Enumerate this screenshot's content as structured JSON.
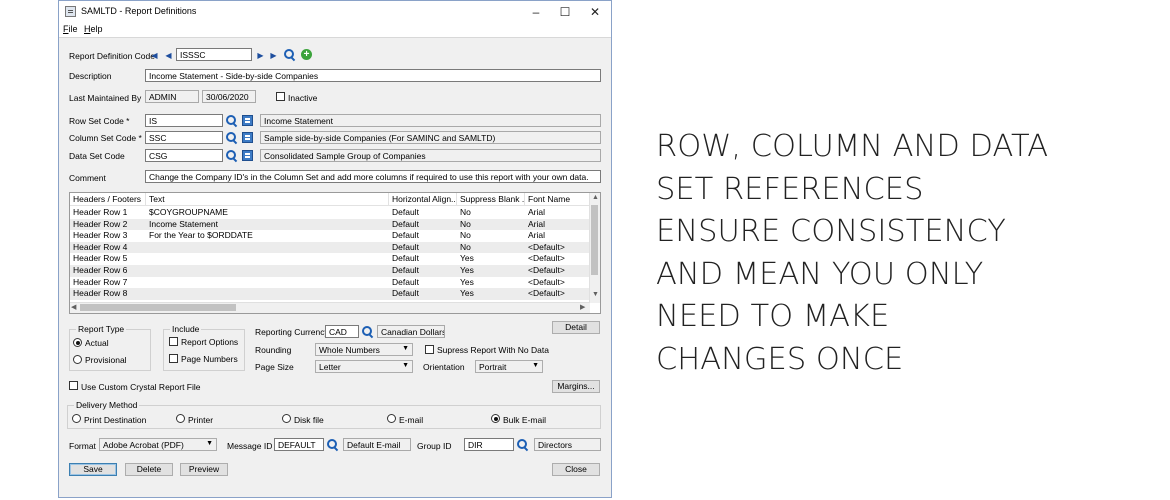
{
  "window": {
    "title": "SAMLTD - Report Definitions"
  },
  "menu": [
    {
      "key": "F",
      "rest": "ile"
    },
    {
      "key": "H",
      "rest": "elp"
    }
  ],
  "form": {
    "report_definition_code_label": "Report Definition Code",
    "report_definition_code": "ISSSC",
    "description_label": "Description",
    "description": "Income Statement - Side-by-side Companies",
    "last_maintained_label": "Last Maintained By",
    "last_maintained_user": "ADMIN",
    "last_maintained_date": "30/06/2020",
    "inactive_label": "Inactive",
    "row_set_label": "Row Set Code *",
    "row_set_code": "IS",
    "row_set_desc": "Income Statement",
    "column_set_label": "Column Set Code *",
    "column_set_code": "SSC",
    "column_set_desc": "Sample side-by-side Companies (For SAMINC and SAMLTD)",
    "data_set_label": "Data Set Code",
    "data_set_code": "CSG",
    "data_set_desc": "Consolidated Sample Group of Companies",
    "comment_label": "Comment",
    "comment": "Change the Company ID's in the Column Set and add more columns if required to use this report with your own data."
  },
  "grid": {
    "columns": [
      "Headers / Footers",
      "Text",
      "Horizontal Align...",
      "Suppress Blank ...",
      "Font Name"
    ],
    "rows": [
      {
        "name": "Header Row 1",
        "text": "$COYGROUPNAME",
        "align": "Default",
        "suppress": "No",
        "font": "Arial"
      },
      {
        "name": "Header Row 2",
        "text": "Income Statement",
        "align": "Default",
        "suppress": "No",
        "font": "Arial"
      },
      {
        "name": "Header Row 3",
        "text": "For the Year to $ORDDATE",
        "align": "Default",
        "suppress": "No",
        "font": "Arial"
      },
      {
        "name": "Header Row 4",
        "text": "",
        "align": "Default",
        "suppress": "No",
        "font": "<Default>"
      },
      {
        "name": "Header Row 5",
        "text": "",
        "align": "Default",
        "suppress": "Yes",
        "font": "<Default>"
      },
      {
        "name": "Header Row 6",
        "text": "",
        "align": "Default",
        "suppress": "Yes",
        "font": "<Default>"
      },
      {
        "name": "Header Row 7",
        "text": "",
        "align": "Default",
        "suppress": "Yes",
        "font": "<Default>"
      },
      {
        "name": "Header Row 8",
        "text": "",
        "align": "Default",
        "suppress": "Yes",
        "font": "<Default>"
      }
    ]
  },
  "options": {
    "report_type_label": "Report Type",
    "actual_label": "Actual",
    "provisional_label": "Provisional",
    "include_label": "Include",
    "report_options_label": "Report Options",
    "page_numbers_label": "Page Numbers",
    "reporting_currency_label": "Reporting Currency",
    "currency_code": "CAD",
    "currency_desc": "Canadian Dollars",
    "rounding_label": "Rounding",
    "rounding_value": "Whole Numbers",
    "supress_label": "Supress Report With No Data",
    "page_size_label": "Page Size",
    "page_size_value": "Letter",
    "orientation_label": "Orientation",
    "orientation_value": "Portrait",
    "detail_label": "Detail",
    "custom_crystal_label": "Use Custom Crystal Report File",
    "margins_label": "Margins..."
  },
  "delivery": {
    "label": "Delivery Method",
    "methods": [
      "Print Destination",
      "Printer",
      "Disk file",
      "E-mail",
      "Bulk E-mail"
    ],
    "selected": "Bulk E-mail"
  },
  "bottom": {
    "format_label": "Format",
    "format_value": "Adobe Acrobat (PDF)",
    "message_id_label": "Message ID",
    "message_id": "DEFAULT",
    "message_desc": "Default E-mail",
    "group_id_label": "Group ID",
    "group_id": "DIR",
    "group_desc": "Directors"
  },
  "buttons": {
    "save": "Save",
    "delete": "Delete",
    "preview": "Preview",
    "close": "Close"
  },
  "promo_lines": [
    "ROW, COLUMN AND DATA",
    "SET REFERENCES",
    "ENSURE CONSISTENCY",
    "AND MEAN YOU ONLY",
    "NEED TO MAKE",
    "CHANGES ONCE"
  ]
}
